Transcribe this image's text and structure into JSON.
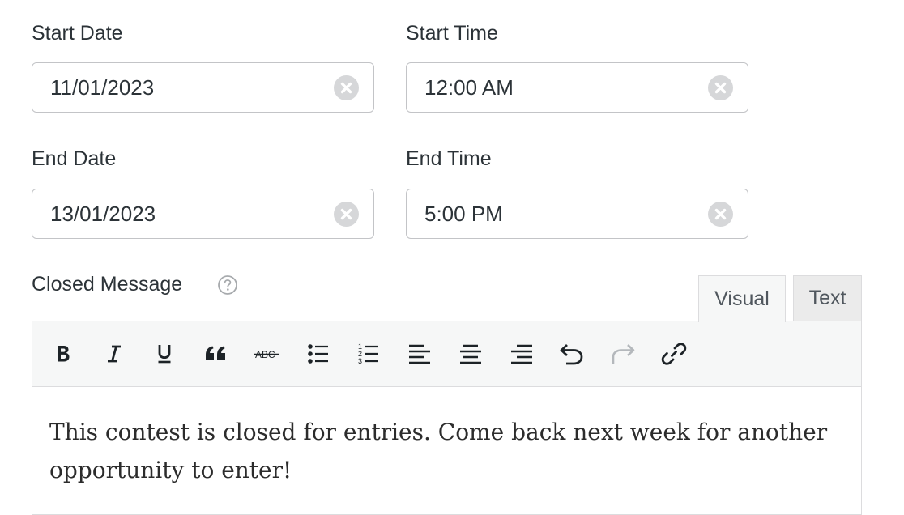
{
  "fields": {
    "start_date": {
      "label": "Start Date",
      "value": "11/01/2023"
    },
    "start_time": {
      "label": "Start Time",
      "value": "12:00 AM"
    },
    "end_date": {
      "label": "End Date",
      "value": "13/01/2023"
    },
    "end_time": {
      "label": "End Time",
      "value": "5:00 PM"
    }
  },
  "closed_message": {
    "label": "Closed Message",
    "tabs": {
      "visual": "Visual",
      "text": "Text"
    },
    "toolbar": [
      "bold-icon",
      "italic-icon",
      "underline-icon",
      "blockquote-icon",
      "strikethrough-icon",
      "bulleted-list-icon",
      "numbered-list-icon",
      "align-left-icon",
      "align-center-icon",
      "align-right-icon",
      "undo-icon",
      "redo-icon",
      "link-icon"
    ],
    "content": "This contest is closed for entries. Come back next week for another opportunity to enter!"
  },
  "colors": {
    "border": "#c3c4c7",
    "toolbar_bg": "#f6f7f7",
    "clear_icon": "#d6d7d9"
  }
}
